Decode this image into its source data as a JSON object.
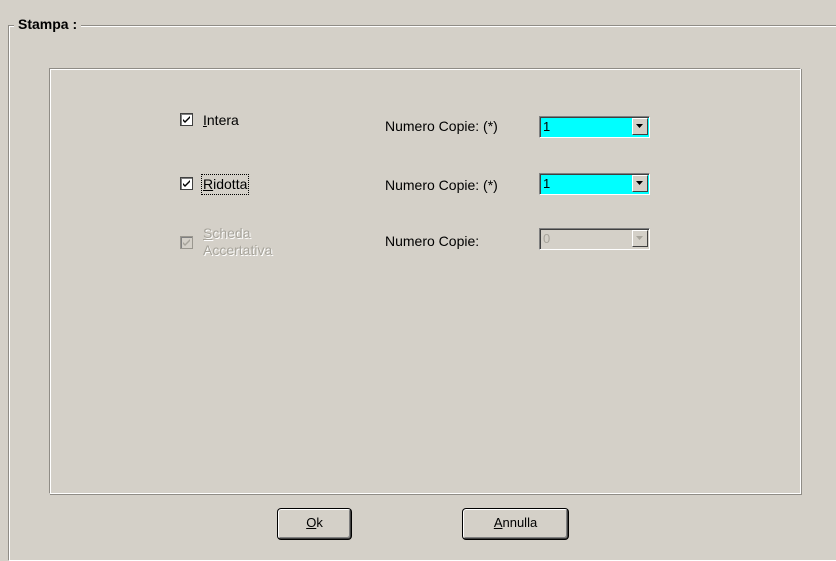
{
  "groupbox": {
    "title": "Stampa :"
  },
  "options": [
    {
      "label_first": "I",
      "label_rest": "ntera",
      "checked": true,
      "enabled": true,
      "copies_label": "Numero Copie: (*)",
      "copies_value": "1"
    },
    {
      "label_first": "R",
      "label_rest": "idotta",
      "checked": true,
      "enabled": true,
      "copies_label": "Numero Copie: (*)",
      "copies_value": "1"
    },
    {
      "label_first": "S",
      "label_rest": "cheda",
      "label_line2": "Accertativa",
      "checked": true,
      "enabled": false,
      "copies_label": "Numero Copie:",
      "copies_value": "0"
    }
  ],
  "buttons": {
    "ok_first": "O",
    "ok_rest": "k",
    "cancel_first": "A",
    "cancel_rest": "nnulla"
  },
  "colors": {
    "window_bg": "#d4d0c8",
    "active_combo": "#00ffff",
    "disabled_text": "#a7a49b"
  }
}
